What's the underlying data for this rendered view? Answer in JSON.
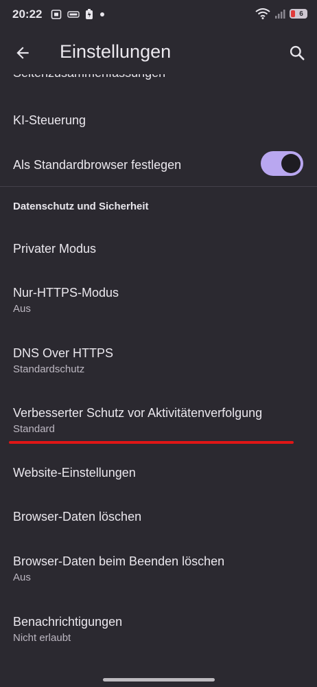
{
  "status_bar": {
    "time": "20:22",
    "battery_level": "6",
    "icons": [
      "screenshot-icon",
      "sim-icon",
      "battery-saver-icon",
      "dot-icon",
      "wifi-icon",
      "signal-icon",
      "battery-icon"
    ]
  },
  "app_bar": {
    "title": "Einstellungen",
    "back_icon": "arrow-back-icon",
    "search_icon": "search-icon"
  },
  "items": {
    "cut_top": "Seitenzusammenfassungen",
    "ki": "KI-Steuerung",
    "default_browser": "Als Standardbrowser festlegen",
    "default_browser_toggle": "on",
    "section_privacy": "Datenschutz und Sicherheit",
    "private_mode": "Privater Modus",
    "https_only": {
      "label": "Nur-HTTPS-Modus",
      "sub": "Aus"
    },
    "dns": {
      "label": "DNS Over HTTPS",
      "sub": "Standardschutz"
    },
    "tracking": {
      "label": "Verbesserter Schutz vor Aktivitätenverfolgung",
      "sub": "Standard"
    },
    "site_settings": "Website-Einstellungen",
    "clear_data": "Browser-Daten löschen",
    "clear_on_exit": {
      "label": "Browser-Daten beim Beenden löschen",
      "sub": "Aus"
    },
    "notifications": {
      "label": "Benachrichtigungen",
      "sub": "Nicht erlaubt"
    }
  },
  "colors": {
    "background": "#2b2930",
    "toggle_on": "#b9a7f0",
    "highlight_line": "#e01616"
  }
}
